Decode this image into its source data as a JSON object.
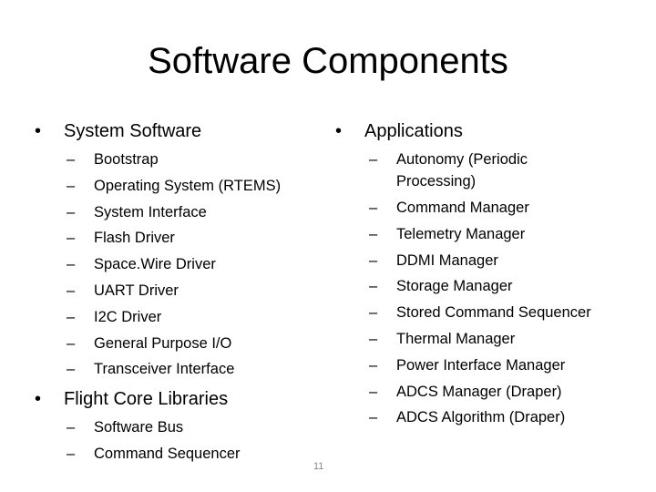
{
  "slide": {
    "title": "Software Components",
    "page_number": "11",
    "bullet_glyph": "•",
    "dash_glyph": "–"
  },
  "system_software": {
    "heading": "System Software",
    "items": [
      "Bootstrap",
      "Operating System (RTEMS)",
      "System Interface",
      "Flash Driver",
      "Space.Wire Driver",
      "UART Driver",
      "I2C Driver",
      "General Purpose I/O",
      "Transceiver Interface"
    ]
  },
  "flight_core": {
    "heading": "Flight Core Libraries",
    "items": [
      "Software Bus",
      "Command Sequencer"
    ]
  },
  "applications": {
    "heading": "Applications",
    "items": [
      "Autonomy (Periodic Processing)",
      "Command Manager",
      "Telemetry Manager",
      "DDMI Manager",
      "Storage Manager",
      "Stored Command Sequencer",
      "Thermal Manager",
      "Power Interface Manager",
      "ADCS Manager (Draper)",
      "ADCS Algorithm (Draper)"
    ]
  }
}
